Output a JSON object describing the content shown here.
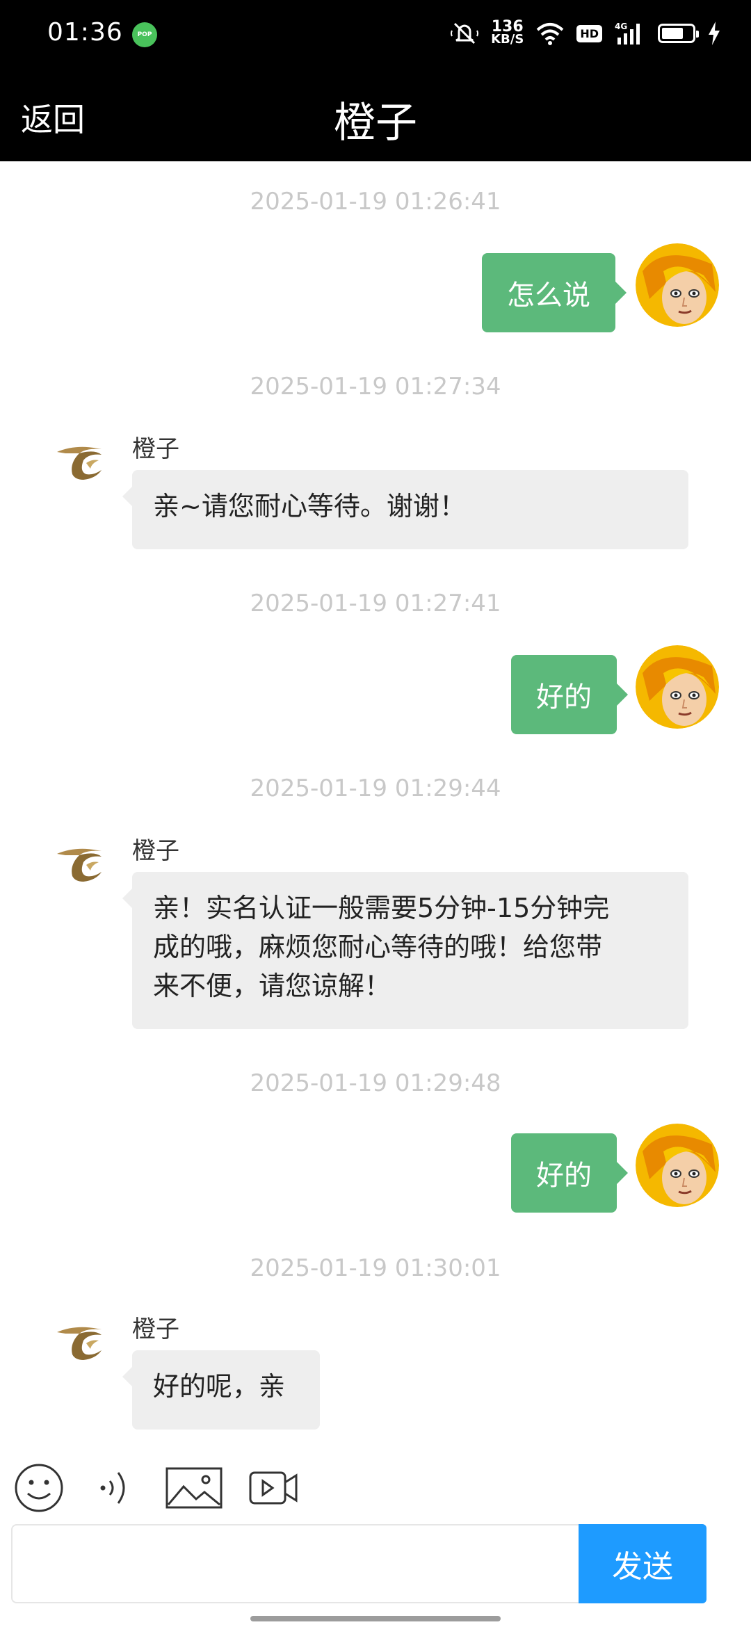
{
  "status_bar": {
    "time": "01:36",
    "pop_label": "POP",
    "net_speed_value": "136",
    "net_speed_unit": "KB/S",
    "hd": "HD",
    "network": "4G"
  },
  "header": {
    "back_label": "返回",
    "title": "橙子"
  },
  "messages": [
    {
      "timestamp": "2025-01-19 01:26:41",
      "direction": "out",
      "text": "怎么说"
    },
    {
      "timestamp": "2025-01-19 01:27:34",
      "direction": "in",
      "sender": "橙子",
      "text": "亲~请您耐心等待。谢谢！"
    },
    {
      "timestamp": "2025-01-19 01:27:41",
      "direction": "out",
      "text": "好的"
    },
    {
      "timestamp": "2025-01-19 01:29:44",
      "direction": "in",
      "sender": "橙子",
      "lines": [
        "亲！实名认证一般需要5分钟-15分钟完",
        "成的哦，麻烦您耐心等待的哦！给您带",
        "来不便，请您谅解！"
      ]
    },
    {
      "timestamp": "2025-01-19 01:29:48",
      "direction": "out",
      "text": "好的"
    },
    {
      "timestamp": "2025-01-19 01:30:01",
      "direction": "in",
      "sender": "橙子",
      "text": "好的呢，亲"
    }
  ],
  "toolbar": {
    "icons": [
      "emoji-icon",
      "voice-icon",
      "image-icon",
      "video-icon"
    ]
  },
  "composer": {
    "value": "",
    "send_label": "发送"
  },
  "colors": {
    "out_bubble": "#5cb97b",
    "in_bubble": "#eeeeee",
    "send_button": "#1e9bff",
    "header_bg": "#000000",
    "timestamp": "#c8c8c8"
  }
}
